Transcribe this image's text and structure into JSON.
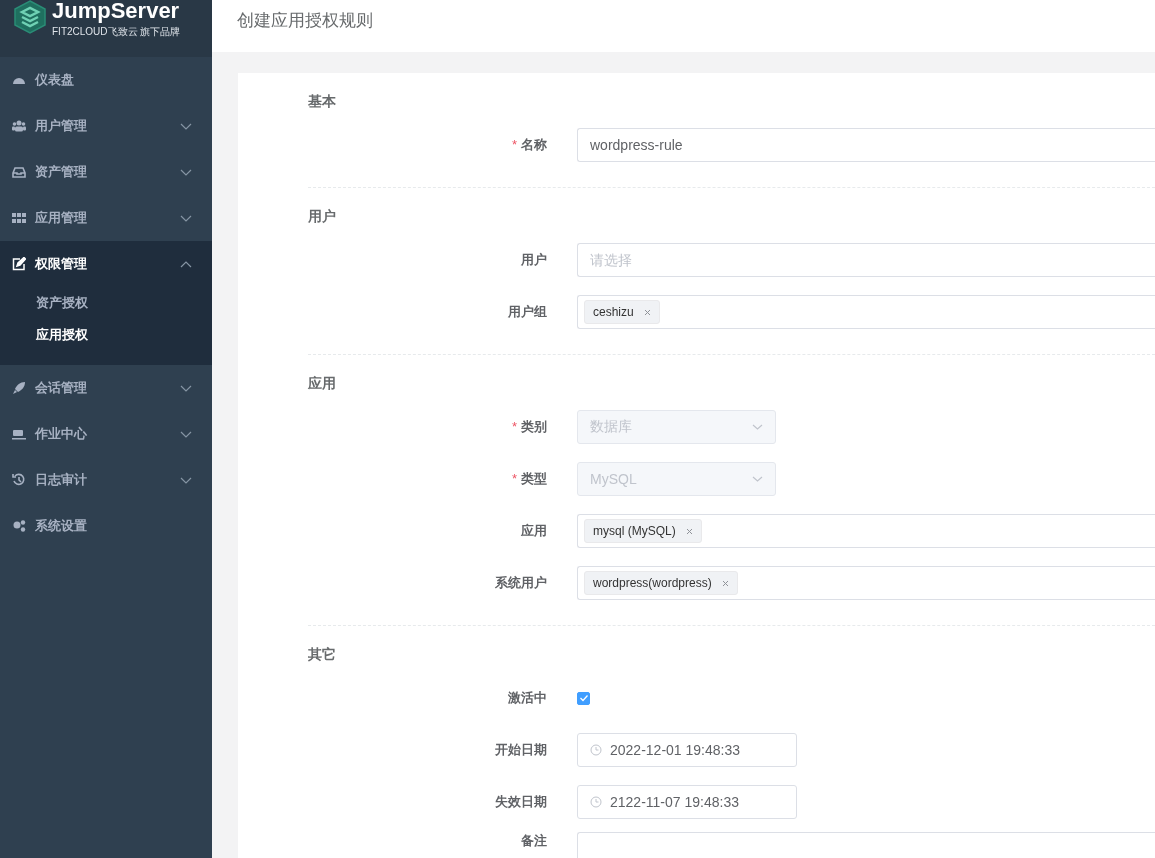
{
  "sidebar": {
    "logo": {
      "name": "JumpServer",
      "tagline": "FIT2CLOUD飞致云 旗下品牌"
    },
    "items": [
      {
        "label": "仪表盘",
        "kind": "link"
      },
      {
        "label": "用户管理",
        "kind": "group",
        "expanded": false
      },
      {
        "label": "资产管理",
        "kind": "group",
        "expanded": false
      },
      {
        "label": "应用管理",
        "kind": "group",
        "expanded": false
      },
      {
        "label": "权限管理",
        "kind": "group",
        "expanded": true,
        "children": [
          {
            "label": "资产授权",
            "selected": false
          },
          {
            "label": "应用授权",
            "selected": true
          }
        ]
      },
      {
        "label": "会话管理",
        "kind": "group",
        "expanded": false
      },
      {
        "label": "作业中心",
        "kind": "group",
        "expanded": false
      },
      {
        "label": "日志审计",
        "kind": "group",
        "expanded": false
      },
      {
        "label": "系统设置",
        "kind": "link"
      }
    ]
  },
  "page_title": "创建应用授权规则",
  "form": {
    "sections": [
      {
        "title": "基本",
        "fields": [
          {
            "label": "名称",
            "required_mark": "*",
            "kind": "text",
            "value": "wordpress-rule"
          }
        ]
      },
      {
        "title": "用户",
        "fields": [
          {
            "label": "用户",
            "kind": "select",
            "placeholder": "请选择"
          },
          {
            "label": "用户组",
            "kind": "tags",
            "tags": [
              "ceshizu"
            ]
          }
        ]
      },
      {
        "title": "应用",
        "fields": [
          {
            "label": "类别",
            "required_mark": "*",
            "kind": "dropdown",
            "disabled": true,
            "value": "数据库"
          },
          {
            "label": "类型",
            "required_mark": "*",
            "kind": "dropdown",
            "disabled": true,
            "value": "MySQL"
          },
          {
            "label": "应用",
            "kind": "tags",
            "tags": [
              "mysql (MySQL)"
            ]
          },
          {
            "label": "系统用户",
            "kind": "tags",
            "tags": [
              "wordpress(wordpress)"
            ]
          }
        ]
      },
      {
        "title": "其它",
        "fields": [
          {
            "label": "激活中",
            "kind": "checkbox",
            "checked": true
          },
          {
            "label": "开始日期",
            "kind": "datetime",
            "value": "2022-12-01 19:48:33"
          },
          {
            "label": "失效日期",
            "kind": "datetime",
            "value": "2122-11-07 19:48:33"
          },
          {
            "label": "备注",
            "kind": "textarea"
          }
        ]
      }
    ]
  }
}
